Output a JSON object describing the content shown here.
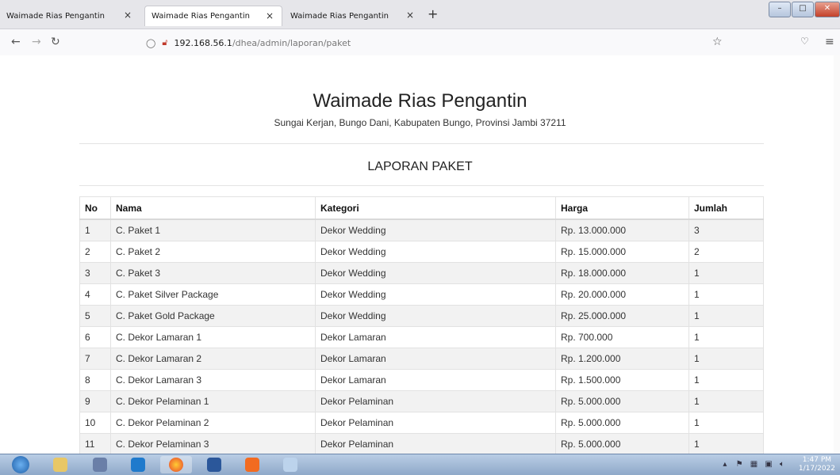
{
  "browser": {
    "tabs": [
      {
        "label": "Waimade Rias Pengantin"
      },
      {
        "label": "Waimade Rias Pengantin"
      },
      {
        "label": "Waimade Rias Pengantin"
      }
    ],
    "close_glyph": "×",
    "new_tab_glyph": "+",
    "url_host": "192.168.56.1",
    "url_path": "/dhea/admin/laporan/paket"
  },
  "page": {
    "title": "Waimade Rias Pengantin",
    "subtitle": "Sungai Kerjan, Bungo Dani, Kabupaten Bungo, Provinsi Jambi 37211",
    "report_title": "LAPORAN PAKET"
  },
  "table": {
    "headers": {
      "no": "No",
      "nama": "Nama",
      "kategori": "Kategori",
      "harga": "Harga",
      "jumlah": "Jumlah"
    },
    "rows": [
      {
        "no": "1",
        "nama": "C. Paket 1",
        "kategori": "Dekor Wedding",
        "harga": "Rp. 13.000.000",
        "jumlah": "3"
      },
      {
        "no": "2",
        "nama": "C. Paket 2",
        "kategori": "Dekor Wedding",
        "harga": "Rp. 15.000.000",
        "jumlah": "2"
      },
      {
        "no": "3",
        "nama": "C. Paket 3",
        "kategori": "Dekor Wedding",
        "harga": "Rp. 18.000.000",
        "jumlah": "1"
      },
      {
        "no": "4",
        "nama": "C. Paket Silver Package",
        "kategori": "Dekor Wedding",
        "harga": "Rp. 20.000.000",
        "jumlah": "1"
      },
      {
        "no": "5",
        "nama": "C. Paket Gold Package",
        "kategori": "Dekor Wedding",
        "harga": "Rp. 25.000.000",
        "jumlah": "1"
      },
      {
        "no": "6",
        "nama": "C. Dekor Lamaran 1",
        "kategori": "Dekor Lamaran",
        "harga": "Rp. 700.000",
        "jumlah": "1"
      },
      {
        "no": "7",
        "nama": "C. Dekor Lamaran 2",
        "kategori": "Dekor Lamaran",
        "harga": "Rp. 1.200.000",
        "jumlah": "1"
      },
      {
        "no": "8",
        "nama": "C. Dekor Lamaran 3",
        "kategori": "Dekor Lamaran",
        "harga": "Rp. 1.500.000",
        "jumlah": "1"
      },
      {
        "no": "9",
        "nama": "C. Dekor Pelaminan 1",
        "kategori": "Dekor Pelaminan",
        "harga": "Rp. 5.000.000",
        "jumlah": "1"
      },
      {
        "no": "10",
        "nama": "C. Dekor Pelaminan 2",
        "kategori": "Dekor Pelaminan",
        "harga": "Rp. 5.000.000",
        "jumlah": "1"
      },
      {
        "no": "11",
        "nama": "C. Dekor Pelaminan 3",
        "kategori": "Dekor Pelaminan",
        "harga": "Rp. 5.000.000",
        "jumlah": "1"
      }
    ]
  },
  "taskbar": {
    "time": "1:47 PM",
    "date": "1/17/2022"
  }
}
